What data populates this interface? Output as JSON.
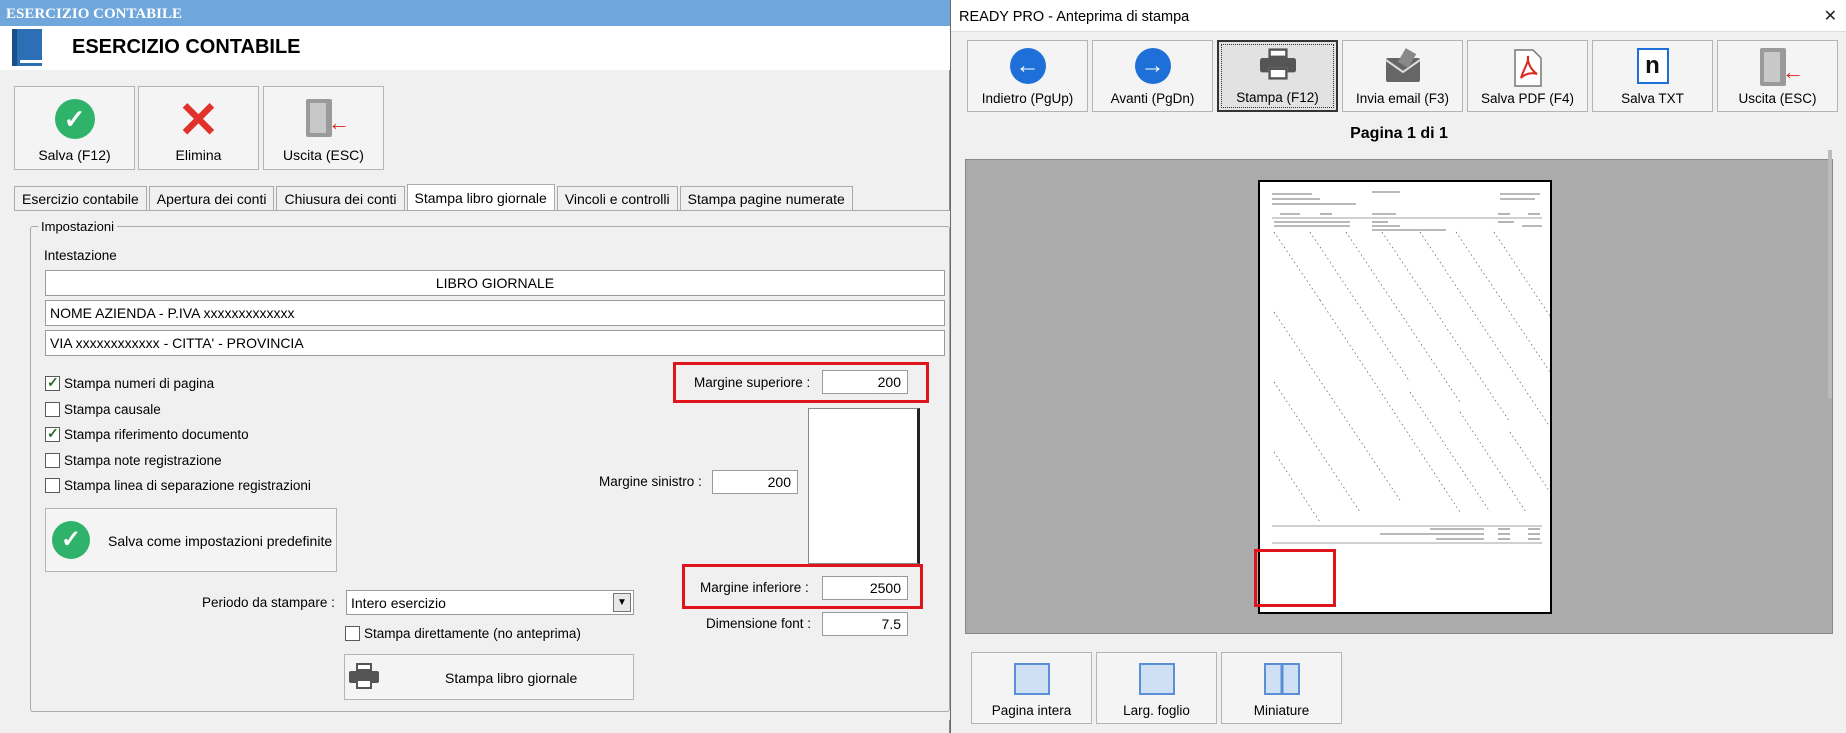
{
  "left": {
    "titlebar": "ESERCIZIO CONTABILE",
    "header_title": "ESERCIZIO CONTABILE",
    "buttons": {
      "save": "Salva (F12)",
      "delete": "Elimina",
      "exit": "Uscita (ESC)"
    },
    "tabs": [
      {
        "label": "Esercizio contabile"
      },
      {
        "label": "Apertura dei conti"
      },
      {
        "label": "Chiusura dei conti"
      },
      {
        "label": "Stampa libro giornale"
      },
      {
        "label": "Vincoli e controlli"
      },
      {
        "label": "Stampa pagine numerate"
      }
    ],
    "group_title": "Impostazioni",
    "intestazione_label": "Intestazione",
    "header_lines": [
      "LIBRO GIORNALE",
      "NOME AZIENDA - P.IVA xxxxxxxxxxxxx",
      "VIA xxxxxxxxxxxx - CITTA' - PROVINCIA"
    ],
    "checkboxes": [
      {
        "label": "Stampa numeri di pagina",
        "checked": true
      },
      {
        "label": "Stampa causale",
        "checked": false
      },
      {
        "label": "Stampa riferimento documento",
        "checked": true
      },
      {
        "label": "Stampa note registrazione",
        "checked": false
      },
      {
        "label": "Stampa linea di separazione registrazioni",
        "checked": false
      }
    ],
    "margins": {
      "top_label": "Margine superiore :",
      "top_value": "200",
      "left_label": "Margine sinistro :",
      "left_value": "200",
      "bottom_label": "Margine inferiore :",
      "bottom_value": "2500",
      "font_label": "Dimensione font :",
      "font_value": "7.5"
    },
    "save_default": "Salva come impostazioni predefinite",
    "period_label": "Periodo da stampare :",
    "period_value": "Intero esercizio",
    "direct_print_label": "Stampa direttamente (no anteprima)",
    "print_button": "Stampa libro giornale"
  },
  "right": {
    "titlebar": "READY PRO - Anteprima di stampa",
    "toolbar": [
      {
        "label": "Indietro (PgUp)",
        "icon": "arrow-left-icon"
      },
      {
        "label": "Avanti (PgDn)",
        "icon": "arrow-right-icon"
      },
      {
        "label": "Stampa (F12)",
        "icon": "printer-icon"
      },
      {
        "label": "Invia email (F3)",
        "icon": "email-icon"
      },
      {
        "label": "Salva PDF (F4)",
        "icon": "pdf-icon"
      },
      {
        "label": "Salva TXT",
        "icon": "txt-icon"
      },
      {
        "label": "Uscita (ESC)",
        "icon": "exit-icon"
      }
    ],
    "page_label": "Pagina 1 di 1",
    "bottom_buttons": [
      {
        "label": "Pagina intera"
      },
      {
        "label": "Larg. foglio"
      },
      {
        "label": "Miniature"
      }
    ]
  },
  "colors": {
    "highlight": "#e0141b",
    "accent_blue": "#1e6fd8",
    "accent_green": "#2fb36b"
  }
}
